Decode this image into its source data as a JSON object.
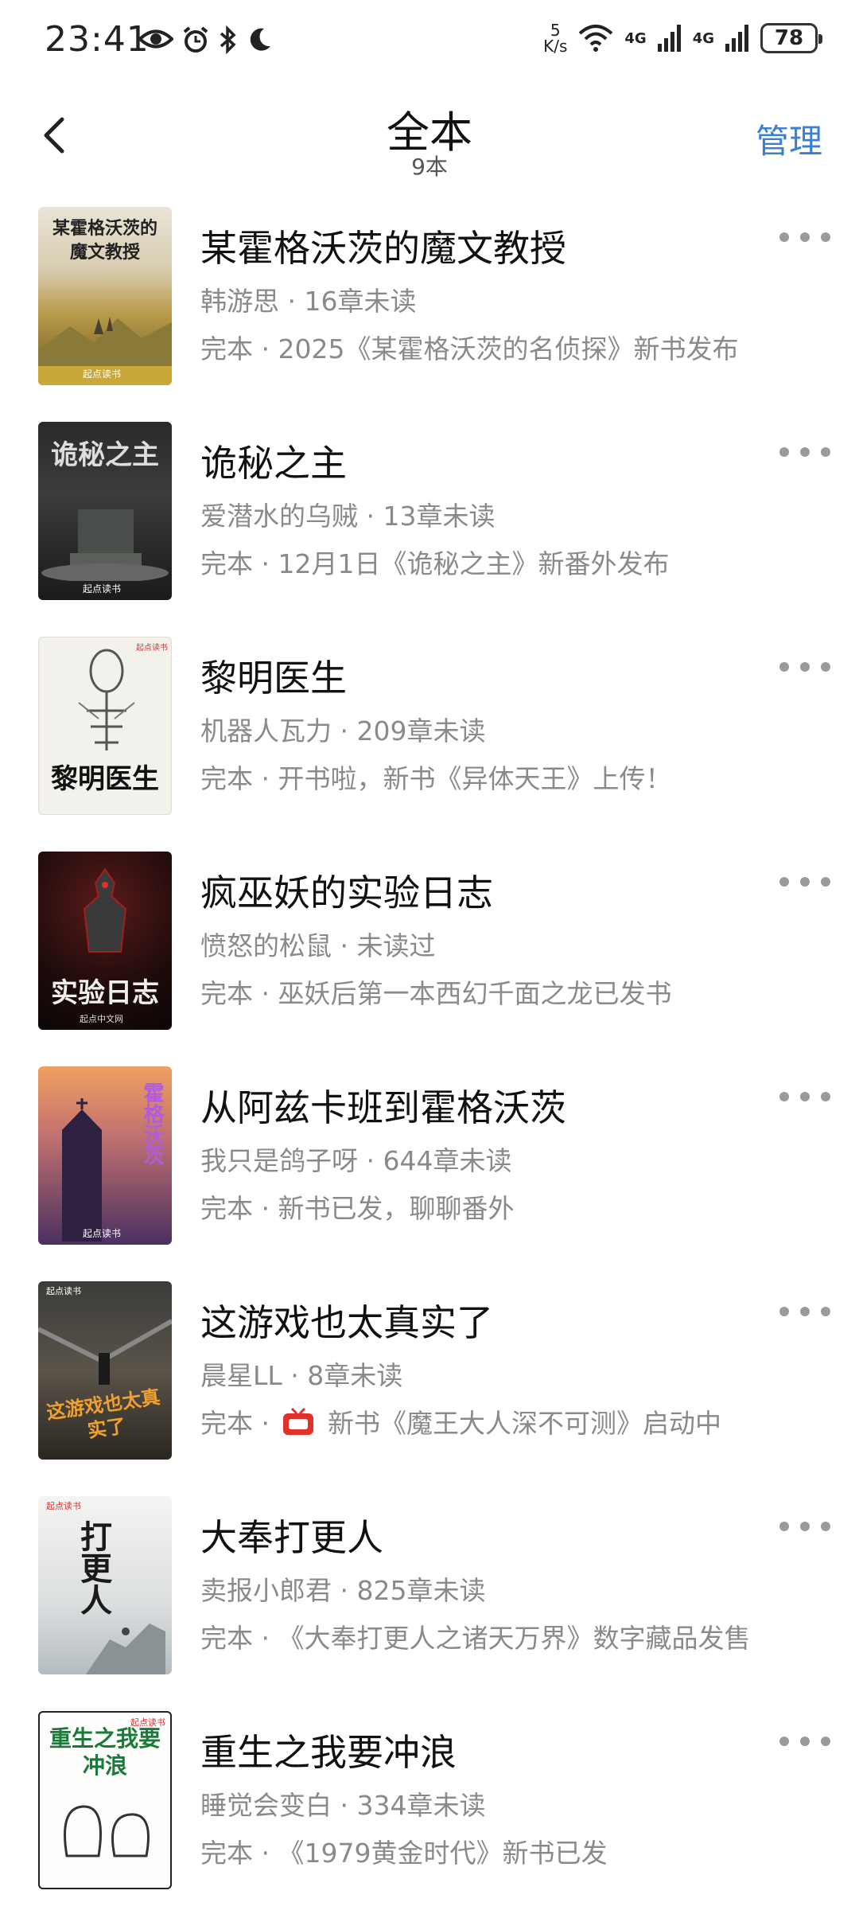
{
  "status_bar": {
    "time": "23:41",
    "speed_value": "5",
    "speed_unit": "K/s",
    "net1": "4G",
    "net2": "4G",
    "battery": "78"
  },
  "header": {
    "title": "全本",
    "subtitle": "9本",
    "manage": "管理"
  },
  "books": [
    {
      "title": "某霍格沃茨的魔文教授",
      "meta": "韩游思 · 16章未读",
      "status": "完本 · 2025《某霍格沃茨的名侦探》新书发布",
      "cover_text": "某霍格沃茨的魔文教授",
      "cover_badge": "起点读书"
    },
    {
      "title": "诡秘之主",
      "meta": "爱潜水的乌贼 · 13章未读",
      "status": "完本 · 12月1日《诡秘之主》新番外发布",
      "cover_text": "诡秘之主",
      "cover_badge": "起点读书"
    },
    {
      "title": "黎明医生",
      "meta": "机器人瓦力 · 209章未读",
      "status": "完本 · 开书啦，新书《异体天王》上传！",
      "cover_text": "黎明医生",
      "cover_badge": "起点读书"
    },
    {
      "title": "疯巫妖的实验日志",
      "meta": "愤怒的松鼠 · 未读过",
      "status": "完本 · 巫妖后第一本西幻千面之龙已发书",
      "cover_text": "实验日志",
      "cover_badge": "起点中文网"
    },
    {
      "title": "从阿兹卡班到霍格沃茨",
      "meta": "我只是鸽子呀 · 644章未读",
      "status": "完本 · 新书已发，聊聊番外",
      "cover_text": "霍格沃茨",
      "cover_badge": "起点读书"
    },
    {
      "title": "这游戏也太真实了",
      "meta": "晨星LL · 8章未读",
      "status_prefix": "完本 · ",
      "status": "新书《魔王大人深不可测》启动中",
      "cover_text": "这游戏也太真实了",
      "cover_badge": "起点读书"
    },
    {
      "title": "大奉打更人",
      "meta": "卖报小郎君 · 825章未读",
      "status": "完本 · 《大奉打更人之诸天万界》数字藏品发售",
      "cover_text": "打更人",
      "cover_badge": "起点读书"
    },
    {
      "title": "重生之我要冲浪",
      "meta": "睡觉会变白 · 334章未读",
      "status": "完本 · 《1979黄金时代》新书已发",
      "cover_text": "重生之我要冲浪",
      "cover_badge": "起点读书"
    }
  ],
  "colors": {
    "accent": "#3b7fd0",
    "meta_gray": "#8a8a8a",
    "badge_red": "#e0312b"
  }
}
